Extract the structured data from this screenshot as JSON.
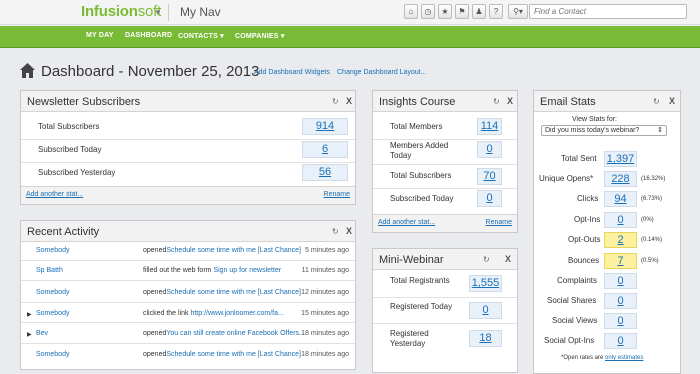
{
  "top": {
    "logo_a": "Infusion",
    "logo_b": "soft",
    "caret": "▼",
    "nav": "My Nav",
    "search_placeholder": "Find a Contact",
    "search_icon": "⚲▾"
  },
  "toolbar": [
    "home-icon",
    "clock-icon",
    "star-icon",
    "tag-icon",
    "user-icon",
    "help-icon"
  ],
  "nav": {
    "myday": "MY DAY",
    "dashboard": "DASHBOARD",
    "contacts": "CONTACTS ▾",
    "companies": "COMPANIES ▾"
  },
  "dash": {
    "title": "Dashboard - November 25, 2013",
    "add": "Add Dashboard Widgets",
    "change": "Change Dashboard Layout..."
  },
  "news": {
    "title": "Newsletter Subscribers",
    "rows": [
      {
        "label": "Total Subscribers",
        "value": "914"
      },
      {
        "label": "Subscribed Today",
        "value": "6"
      },
      {
        "label": "Subscribed Yesterday",
        "value": "56"
      }
    ],
    "add": "Add another stat...",
    "rename": "Rename"
  },
  "activity": {
    "title": "Recent Activity",
    "rows": [
      {
        "name": "Somebody",
        "act": "opened",
        "link": "Schedule some time with me [Last Chance]",
        "time": "5 minutes ago"
      },
      {
        "name": "Sp Batth",
        "act": "filled out the web form ",
        "link": "Sign up for newsletter",
        "time": "11 minutes ago"
      },
      {
        "name": "Somebody",
        "act": "opened",
        "link": "Schedule some time with me [Last Chance]",
        "time": "12 minutes ago"
      },
      {
        "name": "Somebody",
        "act": "clicked the link ",
        "link": "http://www.jonloomer.com/fa...",
        "time": "15 minutes ago"
      },
      {
        "name": "Bev",
        "act": "opened",
        "link": "You can still create online Facebook Offers...",
        "time": "18 minutes ago"
      },
      {
        "name": "Somebody",
        "act": "opened",
        "link": "Schedule some time with me [Last Chance]",
        "time": "18 minutes ago"
      }
    ]
  },
  "insights": {
    "title": "Insights Course",
    "rows": [
      {
        "label": "Total Members",
        "value": "114"
      },
      {
        "label": "Members Added Today",
        "value": "0"
      },
      {
        "label": "Total Subscribers",
        "value": "70"
      },
      {
        "label": "Subscribed Today",
        "value": "0"
      }
    ],
    "add": "Add another stat...",
    "rename": "Rename"
  },
  "webinar": {
    "title": "Mini-Webinar",
    "rows": [
      {
        "label": "Total Registrants",
        "value": "1,555"
      },
      {
        "label": "Registered Today",
        "value": "0"
      },
      {
        "label": "Registered Yesterday",
        "value": "18"
      }
    ],
    "add": "Add another stat...",
    "rename": "Rename"
  },
  "email": {
    "title": "Email Stats",
    "view_label": "View Stats for:",
    "select": "Did you miss today's webinar?",
    "rows": [
      {
        "label": "Total Sent",
        "value": "1,397",
        "pct": ""
      },
      {
        "label": "Unique Opens*",
        "value": "228",
        "pct": "(16.32%)"
      },
      {
        "label": "Clicks",
        "value": "94",
        "pct": "(6.73%)"
      },
      {
        "label": "Opt-Ins",
        "value": "0",
        "pct": "(0%)"
      },
      {
        "label": "Opt-Outs",
        "value": "2",
        "pct": "(0.14%)"
      },
      {
        "label": "Bounces",
        "value": "7",
        "pct": "(0.5%)"
      },
      {
        "label": "Complaints",
        "value": "0",
        "pct": ""
      },
      {
        "label": "Social Shares",
        "value": "0",
        "pct": ""
      },
      {
        "label": "Social Views",
        "value": "0",
        "pct": ""
      },
      {
        "label": "Social Opt-Ins",
        "value": "0",
        "pct": ""
      }
    ],
    "note": "*Open rates are ",
    "note_link": "only estimates"
  },
  "icons": {
    "refresh": "↻",
    "close": "X"
  }
}
